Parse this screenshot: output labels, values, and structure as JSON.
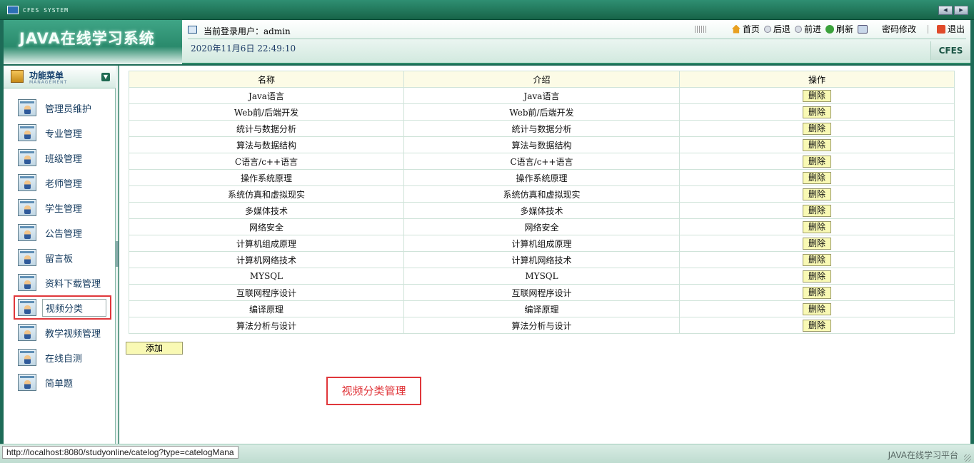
{
  "window": {
    "system_name": "CFES SYSTEM"
  },
  "header": {
    "logo": "JAVA在线学习系统",
    "user_label": "当前登录用户：admin",
    "datetime": "2020年11月6日 22:49:10",
    "nav": {
      "home": "首页",
      "back": "后退",
      "forward": "前进",
      "refresh": "刷新",
      "password": "密码修改",
      "logout": "退出"
    },
    "brand": "CFES"
  },
  "sidebar": {
    "title": "功能菜单",
    "subtitle": "MANAGEMENT",
    "items": [
      {
        "label": "管理员维护"
      },
      {
        "label": "专业管理"
      },
      {
        "label": "班级管理"
      },
      {
        "label": "老师管理"
      },
      {
        "label": "学生管理"
      },
      {
        "label": "公告管理"
      },
      {
        "label": "留言板"
      },
      {
        "label": "资料下载管理"
      },
      {
        "label": "视频分类"
      },
      {
        "label": "教学视频管理"
      },
      {
        "label": "在线自测"
      },
      {
        "label": "简单题"
      }
    ],
    "active_index": 8
  },
  "table": {
    "headers": {
      "name": "名称",
      "intro": "介绍",
      "action": "操作"
    },
    "delete_label": "删除",
    "rows": [
      {
        "name": "Java语言",
        "intro": "Java语言"
      },
      {
        "name": "Web前/后端开发",
        "intro": "Web前/后端开发"
      },
      {
        "name": "统计与数据分析",
        "intro": "统计与数据分析"
      },
      {
        "name": "算法与数据结构",
        "intro": "算法与数据结构"
      },
      {
        "name": "C语言/c++语言",
        "intro": "C语言/c++语言"
      },
      {
        "name": "操作系统原理",
        "intro": "操作系统原理"
      },
      {
        "name": "系统仿真和虚拟现实",
        "intro": "系统仿真和虚拟现实"
      },
      {
        "name": "多媒体技术",
        "intro": "多媒体技术"
      },
      {
        "name": "网络安全",
        "intro": "网络安全"
      },
      {
        "name": "计算机组成原理",
        "intro": "计算机组成原理"
      },
      {
        "name": "计算机网络技术",
        "intro": "计算机网络技术"
      },
      {
        "name": "MYSQL",
        "intro": "MYSQL"
      },
      {
        "name": "互联网程序设计",
        "intro": "互联网程序设计"
      },
      {
        "name": "编译原理",
        "intro": "编译原理"
      },
      {
        "name": "算法分析与设计",
        "intro": "算法分析与设计"
      }
    ]
  },
  "add_label": "添加",
  "page_caption": "视频分类管理",
  "status": {
    "url": "http://localhost:8080/studyonline/catelog?type=catelogMana",
    "right": "JAVA在线学习平台"
  }
}
